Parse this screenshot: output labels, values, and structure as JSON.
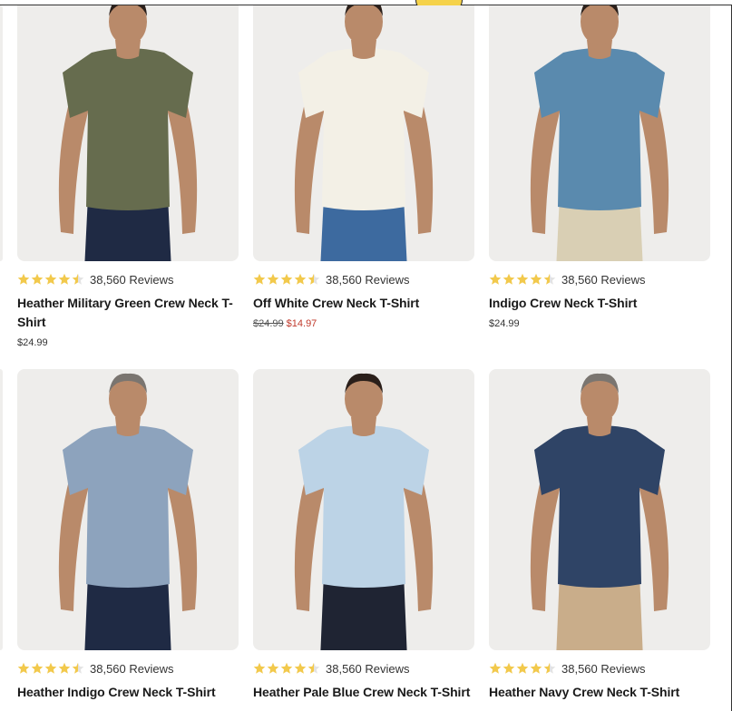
{
  "products": [
    {
      "rating_text": "38,560 Reviews",
      "title": "Heather Military Green Crew Neck T-Shirt",
      "price": "$24.99",
      "old_price": "",
      "sale_price": "",
      "shirt_color": "#666c4e",
      "pants_color": "#1f2a44"
    },
    {
      "rating_text": "38,560 Reviews",
      "title": "Off White Crew Neck T-Shirt",
      "price": "",
      "old_price": "$24.99",
      "sale_price": "$14.97",
      "shirt_color": "#f3f0e6",
      "pants_color": "#3d6a9f"
    },
    {
      "rating_text": "38,560 Reviews",
      "title": "Indigo Crew Neck T-Shirt",
      "price": "$24.99",
      "old_price": "",
      "sale_price": "",
      "shirt_color": "#5a8aae",
      "pants_color": "#d9cfb4"
    },
    {
      "rating_text": "38,560 Reviews",
      "title": "Heather Indigo Crew Neck T-Shirt",
      "price": "",
      "old_price": "",
      "sale_price": "",
      "shirt_color": "#8da3bd",
      "pants_color": "#1f2a44"
    },
    {
      "rating_text": "38,560 Reviews",
      "title": "Heather Pale Blue Crew Neck T-Shirt",
      "price": "",
      "old_price": "",
      "sale_price": "",
      "shirt_color": "#bcd3e6",
      "pants_color": "#1f2433"
    },
    {
      "rating_text": "38,560 Reviews",
      "title": "Heather Navy Crew Neck T-Shirt",
      "price": "",
      "old_price": "",
      "sale_price": "",
      "shirt_color": "#2f4466",
      "pants_color": "#c9ad8a"
    }
  ],
  "rating": {
    "value": 4.5,
    "star_color": "#f2c94c"
  }
}
